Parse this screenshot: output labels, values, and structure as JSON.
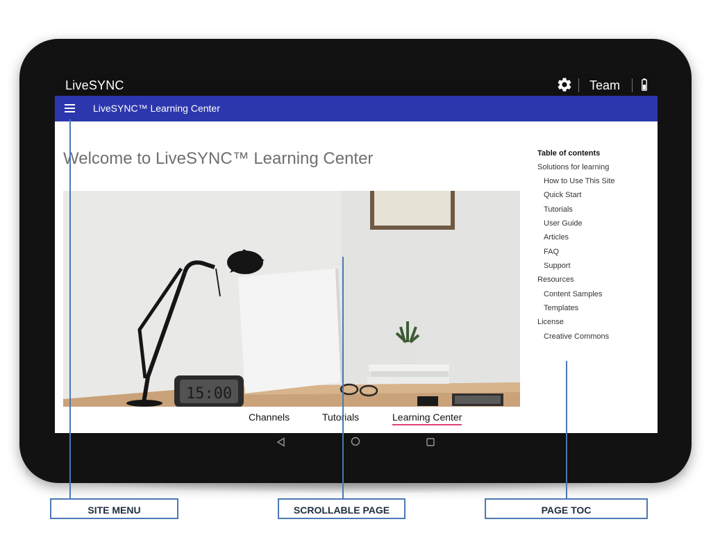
{
  "status_bar": {
    "app_name": "LiveSYNC",
    "settings_icon": "gear-icon",
    "account_label": "Team",
    "battery_icon": "battery-icon"
  },
  "app_bar": {
    "menu_icon": "hamburger-menu-icon",
    "title": "LiveSYNC™ Learning Center"
  },
  "main": {
    "heading": "Welcome to LiveSYNC™ Learning Center",
    "hero_image": "desk-photo",
    "tabs": [
      {
        "label": "Channels",
        "active": false
      },
      {
        "label": "Tutorials",
        "active": false
      },
      {
        "label": "Learning Center",
        "active": true
      }
    ],
    "tab_active_color": "#e0407a"
  },
  "toc": {
    "title": "Table of contents",
    "items": [
      {
        "label": "Solutions for learning",
        "level": 0
      },
      {
        "label": "How to Use This Site",
        "level": 1
      },
      {
        "label": "Quick Start",
        "level": 1
      },
      {
        "label": "Tutorials",
        "level": 1
      },
      {
        "label": "User Guide",
        "level": 1
      },
      {
        "label": "Articles",
        "level": 1
      },
      {
        "label": "FAQ",
        "level": 1
      },
      {
        "label": "Support",
        "level": 1
      },
      {
        "label": "Resources",
        "level": 0
      },
      {
        "label": "Content Samples",
        "level": 1
      },
      {
        "label": "Templates",
        "level": 1
      },
      {
        "label": "License",
        "level": 0
      },
      {
        "label": "Creative Commons",
        "level": 1
      }
    ]
  },
  "android_nav": {
    "back_icon": "back-triangle-icon",
    "home_icon": "home-circle-icon",
    "recent_icon": "recent-apps-square-icon"
  },
  "callouts": {
    "site_menu": "SITE MENU",
    "scrollable_page": "SCROLLABLE PAGE",
    "page_toc": "PAGE TOC"
  },
  "colors": {
    "app_bar": "#2d37ad",
    "status_bar": "#111111",
    "callout": "#4b78b3"
  }
}
